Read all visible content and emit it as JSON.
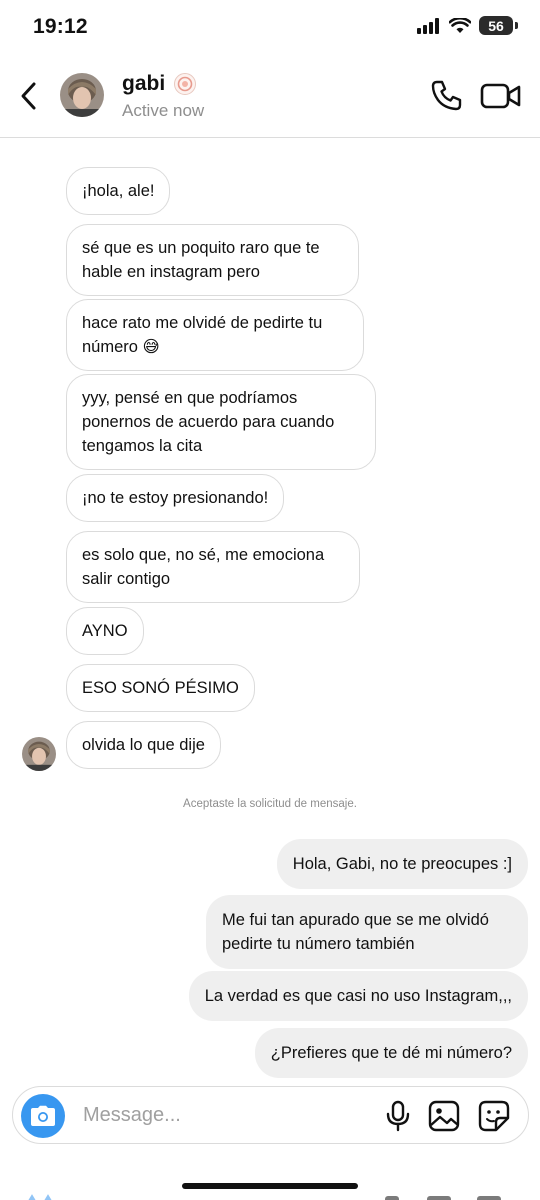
{
  "status_bar": {
    "time": "19:12",
    "battery": "56"
  },
  "header": {
    "contact_name": "gabi",
    "contact_status": "Active now",
    "icons": [
      "back-chevron-icon",
      "avatar",
      "flower-emoji",
      "phone-icon",
      "video-camera-icon"
    ]
  },
  "messages": {
    "incoming": [
      "¡hola, ale!",
      "sé que es un poquito raro que te hable en instagram pero",
      "hace rato me olvidé de pedirte tu número 😅",
      "yyy, pensé en que podríamos ponernos de acuerdo para cuando tengamos la cita",
      "¡no te estoy presionando!",
      "es solo que, no sé, me emociona salir contigo",
      "AYNO",
      "ESO SONÓ PÉSIMO",
      "olvida lo que dije"
    ],
    "system_note": "Aceptaste la solicitud de mensaje.",
    "outgoing": [
      "Hola, Gabi, no te preocupes :]",
      "Me fui tan apurado que se me olvidó pedirte tu número también",
      "La verdad es que casi no uso Instagram,,,",
      "¿Prefieres que te dé mi número?"
    ]
  },
  "composer": {
    "placeholder": "Message...",
    "icons": [
      "camera-icon",
      "microphone-icon",
      "gallery-icon",
      "sticker-icon"
    ]
  },
  "colors": {
    "camera_button": "#3897f0",
    "outgoing_bubble": "#efefef",
    "incoming_border": "#dbdbdb",
    "secondary_text": "#8e8e8e"
  }
}
